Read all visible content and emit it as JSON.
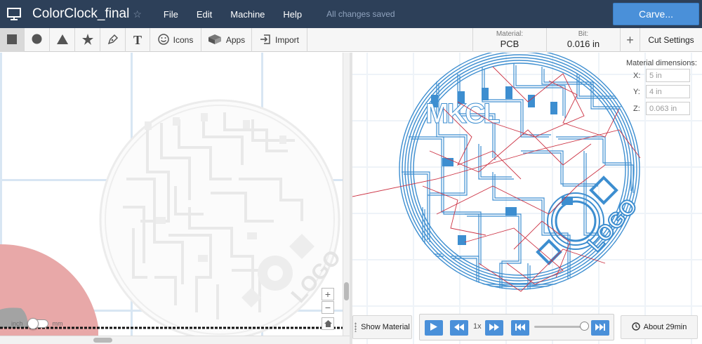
{
  "header": {
    "title": "ColorClock_final",
    "star_glyph": "☆",
    "menus": [
      "File",
      "Edit",
      "Machine",
      "Help"
    ],
    "status": "All changes saved",
    "carve_label": "Carve..."
  },
  "toolbar": {
    "icons_label": "Icons",
    "apps_label": "Apps",
    "import_label": "Import",
    "text_glyph": "T",
    "material_caption": "Material:",
    "material_value": "PCB",
    "bit_caption": "Bit:",
    "bit_value": "0.016 in",
    "plus_glyph": "+",
    "cut_settings_label": "Cut Settings"
  },
  "canvas": {
    "zoom_in": "+",
    "zoom_out": "−",
    "unit_inch": "inch",
    "unit_mm": "mm",
    "unit_selected": "inch"
  },
  "material_dims": {
    "title": "Material dimensions:",
    "x_label": "X:",
    "x_value": "5 in",
    "y_label": "Y:",
    "y_value": "4 in",
    "z_label": "Z:",
    "z_value": "0.063 in"
  },
  "design": {
    "logo_text": "LOGO"
  },
  "playback": {
    "show_material_label": "Show Material",
    "speed": "1x",
    "progress": 1.0,
    "estimate": "About 29min"
  },
  "colors": {
    "topbar": "#2d4059",
    "accent": "#4a90d9",
    "toolpath": "#3d8ed0",
    "travel": "#cc3344",
    "bit_preview": "#e8a8a8"
  }
}
